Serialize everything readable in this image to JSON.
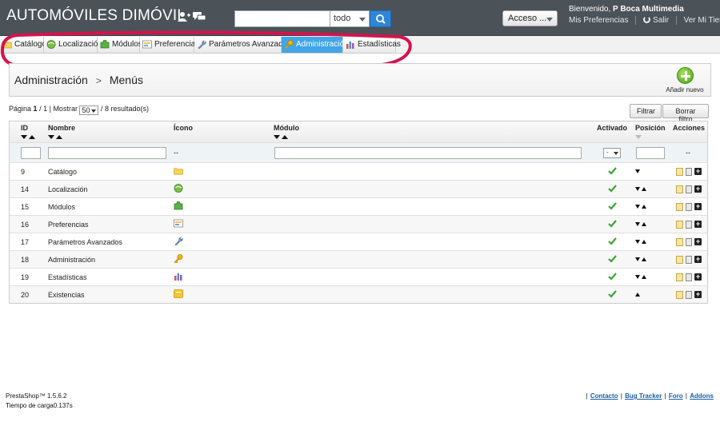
{
  "header": {
    "shop_name": "AUTOMÓVILES DIMÓVIL",
    "search": {
      "value": "",
      "scope": "todo"
    },
    "quick_access": "Acceso ...",
    "welcome_prefix": "Bienvenido, ",
    "welcome_user": "P Boca Multimedia",
    "links": [
      "Mis Preferencias",
      "Salir",
      "Ver Mi Tienda"
    ]
  },
  "tabs": [
    {
      "label": "Catálogo",
      "icon": "folder-icon"
    },
    {
      "label": "Localización",
      "icon": "globe-icon"
    },
    {
      "label": "Módulos",
      "icon": "puzzle-icon"
    },
    {
      "label": "Preferencias",
      "icon": "preferences-icon"
    },
    {
      "label": "Parámetros Avanzados",
      "icon": "wrench-icon"
    },
    {
      "label": "Administración",
      "icon": "key-icon",
      "active": true
    },
    {
      "label": "Estadísticas",
      "icon": "bar-chart-icon"
    }
  ],
  "page": {
    "breadcrumb": [
      "Administración",
      "Menús"
    ],
    "breadcrumb_sep": ">",
    "add_new": "Añadir nuevo"
  },
  "pagination": {
    "page_label": "Página",
    "current": "1",
    "total": "1",
    "show_label": "Mostrar",
    "per_page": "50",
    "results": "8 resultado(s)"
  },
  "buttons": {
    "filter": "Filtrar",
    "reset": "Borrar filtro"
  },
  "table": {
    "columns": {
      "id": "ID",
      "name": "Nombre",
      "icon": "Ícono",
      "module": "Módulo",
      "active": "Activado",
      "position": "Posición",
      "actions": "Acciones"
    },
    "filter": {
      "icon_placeholder": "--",
      "active_select": "-",
      "actions_placeholder": "--"
    },
    "rows": [
      {
        "id": "9",
        "name": "Catálogo",
        "icon": "folder-icon",
        "position": "down"
      },
      {
        "id": "14",
        "name": "Localización",
        "icon": "globe-icon",
        "position": "both"
      },
      {
        "id": "15",
        "name": "Módulos",
        "icon": "puzzle-icon",
        "position": "both"
      },
      {
        "id": "16",
        "name": "Preferencias",
        "icon": "preferences-icon",
        "position": "both"
      },
      {
        "id": "17",
        "name": "Parámetros Avanzados",
        "icon": "wrench-icon",
        "position": "both"
      },
      {
        "id": "18",
        "name": "Administración",
        "icon": "key-icon",
        "position": "both"
      },
      {
        "id": "19",
        "name": "Estadísticas",
        "icon": "bar-chart-icon",
        "position": "both"
      },
      {
        "id": "20",
        "name": "Existencias",
        "icon": "stock-box-icon",
        "position": "up"
      }
    ]
  },
  "footer": {
    "version": "PrestaShop™ 1.5.6.2",
    "load_time": "Tiempo de carga0.137s",
    "links": [
      "Contacto",
      "Bug Tracker",
      "Foro",
      "Addons"
    ]
  },
  "colors": {
    "header_bg": "#4b5258",
    "active_tab": "#42a5e8",
    "accent_blue": "#2f86d6",
    "annotation_red": "#d6124c",
    "check_green": "#3aa635"
  }
}
